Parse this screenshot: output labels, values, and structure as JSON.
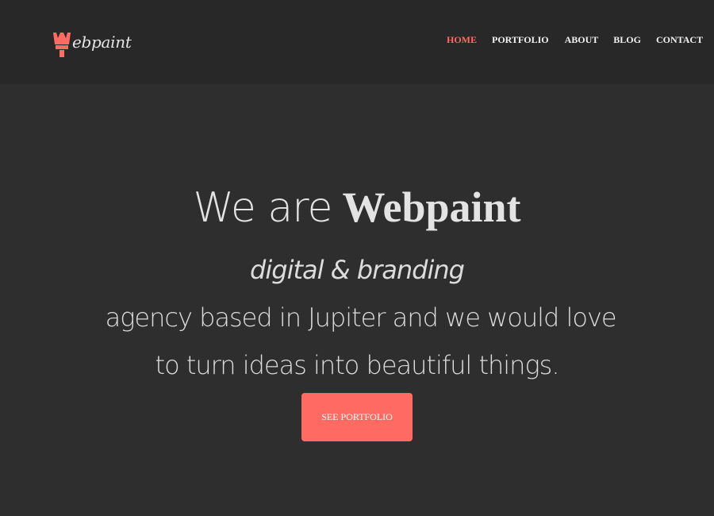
{
  "brand": {
    "logo_icon": "paint-brush-icon",
    "name": "ebpaint",
    "accent_color": "#ff6b63"
  },
  "nav": {
    "items": [
      {
        "label": "HOME",
        "active": true
      },
      {
        "label": "PORTFOLIO",
        "active": false
      },
      {
        "label": "ABOUT",
        "active": false
      },
      {
        "label": "BLOG",
        "active": false
      },
      {
        "label": "CONTACT",
        "active": false
      }
    ]
  },
  "hero": {
    "title_prefix": "We are",
    "title_brand": "Webpaint",
    "subtitle_emphasis_1": "digital",
    "subtitle_ampersand": " & ",
    "subtitle_emphasis_2": "branding",
    "subtitle_line1_rest": " agency based in Jupiter and we would love",
    "subtitle_line2": "to turn ideas into beautiful things."
  },
  "cta": {
    "label": "SEE PORTFOLIO"
  }
}
